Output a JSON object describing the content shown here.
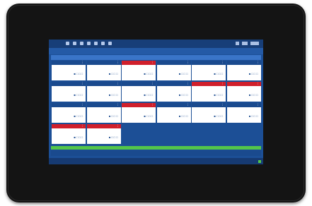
{
  "topbar": {
    "icons": [
      "menu-icon",
      "home-icon",
      "list-icon",
      "settings-icon",
      "chart-icon",
      "user-icon",
      "grid-icon"
    ],
    "right_icons": [
      "bell-icon",
      "wifi-icon",
      "battery-icon"
    ]
  },
  "subbar": {
    "left": "",
    "right": ""
  },
  "group_header": "",
  "tiles": [
    {
      "state": "normal",
      "label": "",
      "value": "",
      "footer": ""
    },
    {
      "state": "normal",
      "label": "",
      "value": "",
      "footer": ""
    },
    {
      "state": "alarm",
      "label": "",
      "value": "",
      "footer": ""
    },
    {
      "state": "normal",
      "label": "",
      "value": "",
      "footer": ""
    },
    {
      "state": "normal",
      "label": "",
      "value": "",
      "footer": ""
    },
    {
      "state": "normal",
      "label": "",
      "value": "",
      "footer": ""
    },
    {
      "state": "normal",
      "label": "",
      "value": "",
      "footer": ""
    },
    {
      "state": "normal",
      "label": "",
      "value": "",
      "footer": ""
    },
    {
      "state": "normal",
      "label": "",
      "value": "",
      "footer": ""
    },
    {
      "state": "normal",
      "label": "",
      "value": "",
      "footer": ""
    },
    {
      "state": "alarm",
      "label": "",
      "value": "",
      "footer": ""
    },
    {
      "state": "alarm",
      "label": "",
      "value": "",
      "footer": ""
    },
    {
      "state": "normal",
      "label": "",
      "value": "",
      "footer": ""
    },
    {
      "state": "normal",
      "label": "",
      "value": "",
      "footer": ""
    },
    {
      "state": "alarm",
      "label": "",
      "value": "",
      "footer": ""
    },
    {
      "state": "normal",
      "label": "",
      "value": "",
      "footer": ""
    },
    {
      "state": "normal",
      "label": "",
      "value": "",
      "footer": ""
    },
    {
      "state": "normal",
      "label": "",
      "value": "",
      "footer": ""
    },
    {
      "state": "alarm",
      "label": "",
      "value": "",
      "footer": ""
    },
    {
      "state": "alarm",
      "label": "",
      "value": "",
      "footer": ""
    }
  ],
  "lower_bar": "",
  "status": {
    "left": "",
    "right_line1": "",
    "right_line2": ""
  },
  "colors": {
    "screen_bg": "#1c4f96",
    "tile_header": "#1a4a8e",
    "alarm": "#d01f2b",
    "ok": "#53c64a"
  }
}
